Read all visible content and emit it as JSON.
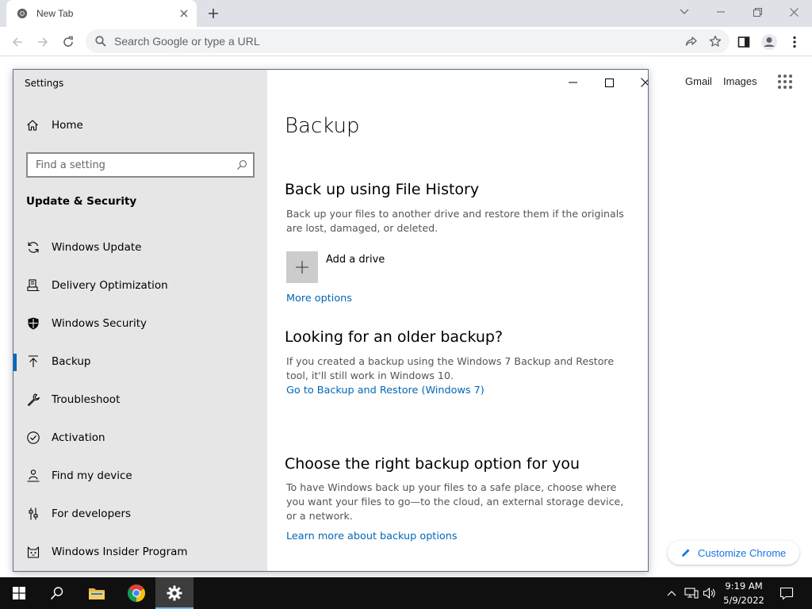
{
  "browser": {
    "tab": {
      "title": "New Tab"
    },
    "omnibox": {
      "placeholder": "Search Google or type a URL"
    },
    "ntp": {
      "gmail": "Gmail",
      "images": "Images",
      "customize": "Customize Chrome"
    }
  },
  "settings": {
    "window_title": "Settings",
    "home": "Home",
    "search_placeholder": "Find a setting",
    "section": "Update & Security",
    "nav": [
      {
        "label": "Windows Update",
        "icon": "sync-icon"
      },
      {
        "label": "Delivery Optimization",
        "icon": "delivery-icon"
      },
      {
        "label": "Windows Security",
        "icon": "shield-icon"
      },
      {
        "label": "Backup",
        "icon": "upload-arrow-icon",
        "active": true
      },
      {
        "label": "Troubleshoot",
        "icon": "wrench-icon"
      },
      {
        "label": "Activation",
        "icon": "check-circle-icon"
      },
      {
        "label": "Find my device",
        "icon": "person-locate-icon"
      },
      {
        "label": "For developers",
        "icon": "developer-sliders-icon"
      },
      {
        "label": "Windows Insider Program",
        "icon": "cat-icon"
      }
    ],
    "content": {
      "title": "Backup",
      "file_history": {
        "heading": "Back up using File History",
        "desc": "Back up your files to another drive and restore them if the originals are lost, damaged, or deleted.",
        "add_drive": "Add a drive",
        "more_options": "More options"
      },
      "older": {
        "heading": "Looking for an older backup?",
        "desc": "If you created a backup using the Windows 7 Backup and Restore tool, it'll still work in Windows 10.",
        "link": "Go to Backup and Restore (Windows 7)"
      },
      "choose": {
        "heading": "Choose the right backup option for you",
        "desc": "To have Windows back up your files to a safe place, choose where you want your files to go—to the cloud, an external storage device, or a network.",
        "link": "Learn more about backup options"
      }
    }
  },
  "taskbar": {
    "time": "9:19 AM",
    "date": "5/9/2022"
  },
  "colors": {
    "accent": "#0067c0",
    "link": "#0067b8",
    "taskbar": "#101010",
    "chrome_frame": "#dee1e6"
  }
}
